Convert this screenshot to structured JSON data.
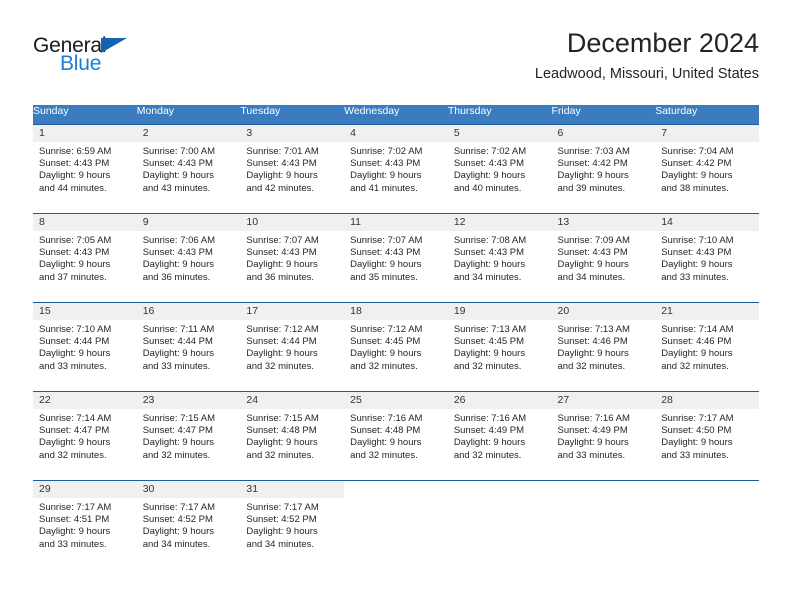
{
  "brand": {
    "name_top": "General",
    "name_bottom": "Blue",
    "triangle_icon": "triangle-icon",
    "colors": {
      "dark": "#1a1a1a",
      "blue": "#1a7fd4",
      "triangle": "#1463ac"
    }
  },
  "header": {
    "title": "December 2024",
    "subtitle": "Leadwood, Missouri, United States"
  },
  "calendar": {
    "header_bg": "#3a7cbe",
    "row_rule": "#1f5c9e",
    "daynum_bg": "#f0f0f0",
    "weekdays": [
      "Sunday",
      "Monday",
      "Tuesday",
      "Wednesday",
      "Thursday",
      "Friday",
      "Saturday"
    ],
    "weeks": [
      [
        {
          "day": "1",
          "sunrise": "Sunrise: 6:59 AM",
          "sunset": "Sunset: 4:43 PM",
          "daylight1": "Daylight: 9 hours",
          "daylight2": "and 44 minutes."
        },
        {
          "day": "2",
          "sunrise": "Sunrise: 7:00 AM",
          "sunset": "Sunset: 4:43 PM",
          "daylight1": "Daylight: 9 hours",
          "daylight2": "and 43 minutes."
        },
        {
          "day": "3",
          "sunrise": "Sunrise: 7:01 AM",
          "sunset": "Sunset: 4:43 PM",
          "daylight1": "Daylight: 9 hours",
          "daylight2": "and 42 minutes."
        },
        {
          "day": "4",
          "sunrise": "Sunrise: 7:02 AM",
          "sunset": "Sunset: 4:43 PM",
          "daylight1": "Daylight: 9 hours",
          "daylight2": "and 41 minutes."
        },
        {
          "day": "5",
          "sunrise": "Sunrise: 7:02 AM",
          "sunset": "Sunset: 4:43 PM",
          "daylight1": "Daylight: 9 hours",
          "daylight2": "and 40 minutes."
        },
        {
          "day": "6",
          "sunrise": "Sunrise: 7:03 AM",
          "sunset": "Sunset: 4:42 PM",
          "daylight1": "Daylight: 9 hours",
          "daylight2": "and 39 minutes."
        },
        {
          "day": "7",
          "sunrise": "Sunrise: 7:04 AM",
          "sunset": "Sunset: 4:42 PM",
          "daylight1": "Daylight: 9 hours",
          "daylight2": "and 38 minutes."
        }
      ],
      [
        {
          "day": "8",
          "sunrise": "Sunrise: 7:05 AM",
          "sunset": "Sunset: 4:43 PM",
          "daylight1": "Daylight: 9 hours",
          "daylight2": "and 37 minutes."
        },
        {
          "day": "9",
          "sunrise": "Sunrise: 7:06 AM",
          "sunset": "Sunset: 4:43 PM",
          "daylight1": "Daylight: 9 hours",
          "daylight2": "and 36 minutes."
        },
        {
          "day": "10",
          "sunrise": "Sunrise: 7:07 AM",
          "sunset": "Sunset: 4:43 PM",
          "daylight1": "Daylight: 9 hours",
          "daylight2": "and 36 minutes."
        },
        {
          "day": "11",
          "sunrise": "Sunrise: 7:07 AM",
          "sunset": "Sunset: 4:43 PM",
          "daylight1": "Daylight: 9 hours",
          "daylight2": "and 35 minutes."
        },
        {
          "day": "12",
          "sunrise": "Sunrise: 7:08 AM",
          "sunset": "Sunset: 4:43 PM",
          "daylight1": "Daylight: 9 hours",
          "daylight2": "and 34 minutes."
        },
        {
          "day": "13",
          "sunrise": "Sunrise: 7:09 AM",
          "sunset": "Sunset: 4:43 PM",
          "daylight1": "Daylight: 9 hours",
          "daylight2": "and 34 minutes."
        },
        {
          "day": "14",
          "sunrise": "Sunrise: 7:10 AM",
          "sunset": "Sunset: 4:43 PM",
          "daylight1": "Daylight: 9 hours",
          "daylight2": "and 33 minutes."
        }
      ],
      [
        {
          "day": "15",
          "sunrise": "Sunrise: 7:10 AM",
          "sunset": "Sunset: 4:44 PM",
          "daylight1": "Daylight: 9 hours",
          "daylight2": "and 33 minutes."
        },
        {
          "day": "16",
          "sunrise": "Sunrise: 7:11 AM",
          "sunset": "Sunset: 4:44 PM",
          "daylight1": "Daylight: 9 hours",
          "daylight2": "and 33 minutes."
        },
        {
          "day": "17",
          "sunrise": "Sunrise: 7:12 AM",
          "sunset": "Sunset: 4:44 PM",
          "daylight1": "Daylight: 9 hours",
          "daylight2": "and 32 minutes."
        },
        {
          "day": "18",
          "sunrise": "Sunrise: 7:12 AM",
          "sunset": "Sunset: 4:45 PM",
          "daylight1": "Daylight: 9 hours",
          "daylight2": "and 32 minutes."
        },
        {
          "day": "19",
          "sunrise": "Sunrise: 7:13 AM",
          "sunset": "Sunset: 4:45 PM",
          "daylight1": "Daylight: 9 hours",
          "daylight2": "and 32 minutes."
        },
        {
          "day": "20",
          "sunrise": "Sunrise: 7:13 AM",
          "sunset": "Sunset: 4:46 PM",
          "daylight1": "Daylight: 9 hours",
          "daylight2": "and 32 minutes."
        },
        {
          "day": "21",
          "sunrise": "Sunrise: 7:14 AM",
          "sunset": "Sunset: 4:46 PM",
          "daylight1": "Daylight: 9 hours",
          "daylight2": "and 32 minutes."
        }
      ],
      [
        {
          "day": "22",
          "sunrise": "Sunrise: 7:14 AM",
          "sunset": "Sunset: 4:47 PM",
          "daylight1": "Daylight: 9 hours",
          "daylight2": "and 32 minutes."
        },
        {
          "day": "23",
          "sunrise": "Sunrise: 7:15 AM",
          "sunset": "Sunset: 4:47 PM",
          "daylight1": "Daylight: 9 hours",
          "daylight2": "and 32 minutes."
        },
        {
          "day": "24",
          "sunrise": "Sunrise: 7:15 AM",
          "sunset": "Sunset: 4:48 PM",
          "daylight1": "Daylight: 9 hours",
          "daylight2": "and 32 minutes."
        },
        {
          "day": "25",
          "sunrise": "Sunrise: 7:16 AM",
          "sunset": "Sunset: 4:48 PM",
          "daylight1": "Daylight: 9 hours",
          "daylight2": "and 32 minutes."
        },
        {
          "day": "26",
          "sunrise": "Sunrise: 7:16 AM",
          "sunset": "Sunset: 4:49 PM",
          "daylight1": "Daylight: 9 hours",
          "daylight2": "and 32 minutes."
        },
        {
          "day": "27",
          "sunrise": "Sunrise: 7:16 AM",
          "sunset": "Sunset: 4:49 PM",
          "daylight1": "Daylight: 9 hours",
          "daylight2": "and 33 minutes."
        },
        {
          "day": "28",
          "sunrise": "Sunrise: 7:17 AM",
          "sunset": "Sunset: 4:50 PM",
          "daylight1": "Daylight: 9 hours",
          "daylight2": "and 33 minutes."
        }
      ],
      [
        {
          "day": "29",
          "sunrise": "Sunrise: 7:17 AM",
          "sunset": "Sunset: 4:51 PM",
          "daylight1": "Daylight: 9 hours",
          "daylight2": "and 33 minutes."
        },
        {
          "day": "30",
          "sunrise": "Sunrise: 7:17 AM",
          "sunset": "Sunset: 4:52 PM",
          "daylight1": "Daylight: 9 hours",
          "daylight2": "and 34 minutes."
        },
        {
          "day": "31",
          "sunrise": "Sunrise: 7:17 AM",
          "sunset": "Sunset: 4:52 PM",
          "daylight1": "Daylight: 9 hours",
          "daylight2": "and 34 minutes."
        },
        {
          "day": "",
          "sunrise": "",
          "sunset": "",
          "daylight1": "",
          "daylight2": ""
        },
        {
          "day": "",
          "sunrise": "",
          "sunset": "",
          "daylight1": "",
          "daylight2": ""
        },
        {
          "day": "",
          "sunrise": "",
          "sunset": "",
          "daylight1": "",
          "daylight2": ""
        },
        {
          "day": "",
          "sunrise": "",
          "sunset": "",
          "daylight1": "",
          "daylight2": ""
        }
      ]
    ]
  }
}
